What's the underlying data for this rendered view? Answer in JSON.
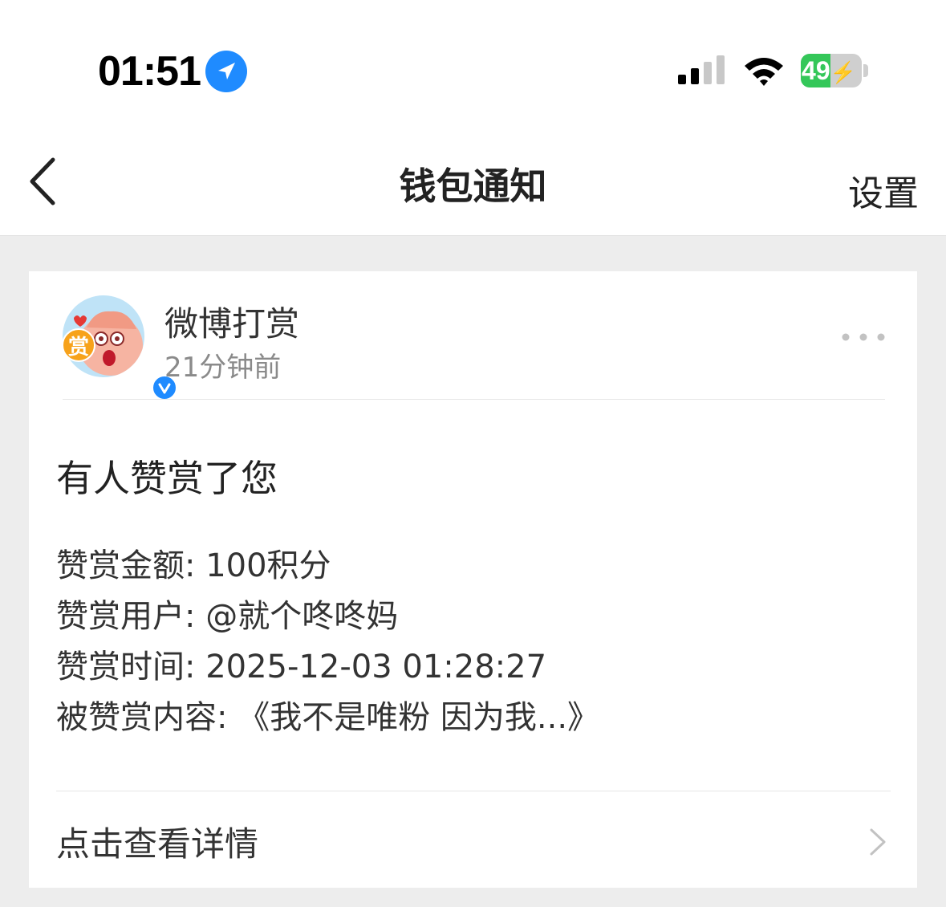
{
  "status_bar": {
    "time": "01:51",
    "battery_level": "49",
    "battery_fraction": 0.49,
    "icons": [
      "location-arrow-icon",
      "cellular-signal-icon",
      "wifi-icon",
      "battery-charging-icon"
    ]
  },
  "nav": {
    "title": "钱包通知",
    "settings_label": "设置",
    "back_icon": "chevron-left-icon"
  },
  "message": {
    "sender": "微博打赏",
    "time_ago": "21分钟前",
    "avatar_badge_text": "赏",
    "title": "有人赞赏了您",
    "details": {
      "amount": "赞赏金额: 100积分",
      "user": "赞赏用户: @就个咚咚妈",
      "time": "赞赏时间: 2025-12-03 01:28:27",
      "content": "被赞赏内容: 《我不是唯粉 因为我...》"
    },
    "footer_label": "点击查看详情"
  },
  "colors": {
    "accent_blue": "#1f8bff",
    "battery_green": "#34c759",
    "background": "#ededed",
    "card": "#ffffff"
  }
}
